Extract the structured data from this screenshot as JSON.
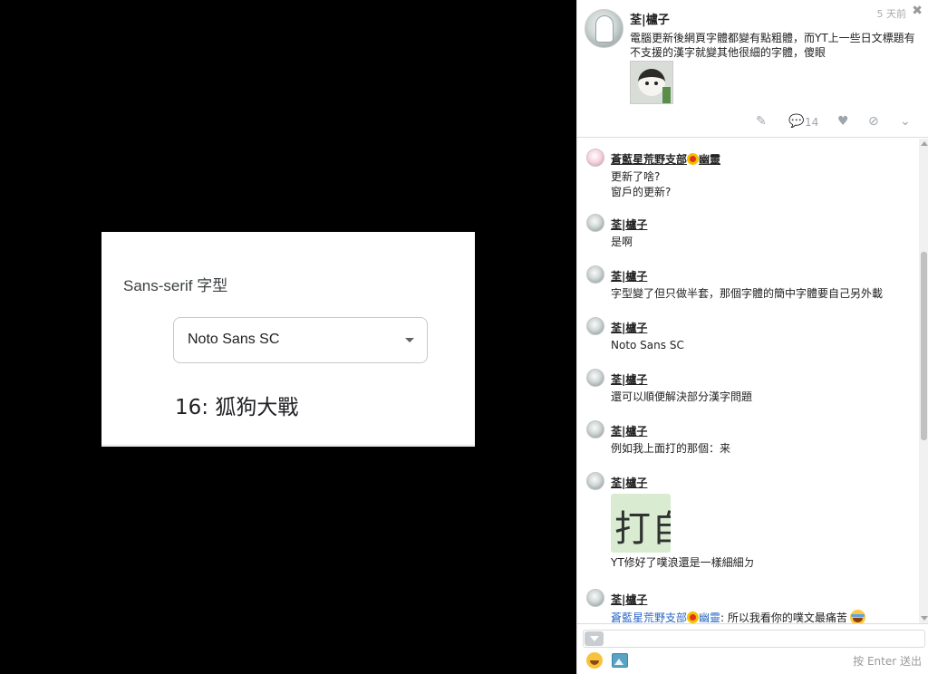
{
  "image_panel": {
    "section_label": "Sans-serif 字型",
    "select_value": "Noto Sans SC",
    "preview_text": "16: 狐狗大戰"
  },
  "post": {
    "author": "荃|櫨子",
    "time": "5 天前",
    "close_label": "✖",
    "content": "電腦更新後網頁字體都變有點粗體，而YT上一些日文標題有不支援的漢字就變其他很細的字體，傻眼",
    "actions": {
      "edit_icon": "✎",
      "comment_icon": "💬",
      "comment_count": "14",
      "like_icon": "♥",
      "replurk_icon": "⊘",
      "more_icon": "⌄"
    }
  },
  "responses": [
    {
      "author_a": "蒼藍星荒野支部",
      "author_b": "幽靈",
      "text_1": "更新了啥?",
      "text_2": "窗戶的更新?"
    },
    {
      "author": "荃|櫨子",
      "text": "是啊"
    },
    {
      "author": "荃|櫨子",
      "text": "字型變了但只做半套，那個字體的簡中字體要自己另外載"
    },
    {
      "author": "荃|櫨子",
      "text": "Noto Sans SC"
    },
    {
      "author": "荃|櫨子",
      "text": "還可以順便解決部分漢字問題"
    },
    {
      "author": "荃|櫨子",
      "text": "例如我上面打的那個：来"
    },
    {
      "author": "荃|櫨子",
      "image_text": "打自",
      "text": "YT修好了噗浪還是一樣細細ㄉ"
    },
    {
      "author": "荃|櫨子",
      "mention_a": "蒼藍星荒野支部",
      "mention_b": "幽靈",
      "text": ": 所以我看你的噗文最痛苦"
    }
  ],
  "composer": {
    "send_hint": "按 Enter 送出"
  }
}
